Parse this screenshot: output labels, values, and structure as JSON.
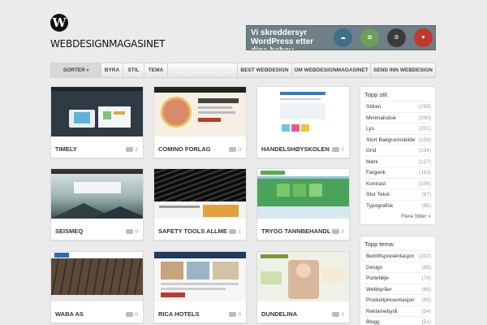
{
  "site": {
    "logo_letter": "W",
    "name": "WEBDESIGNMAGASINET"
  },
  "banner": {
    "text": "Vi skreddersyr WordPress etter dine behov",
    "accent": "#6e7f86"
  },
  "nav": {
    "left": [
      {
        "label": "SORTER",
        "active": true
      },
      {
        "label": "BYRA"
      },
      {
        "label": "STIL"
      },
      {
        "label": "TEMA"
      }
    ],
    "right": [
      {
        "label": "BEST WEBDESIGN"
      },
      {
        "label": "OM WEBDESIGNMAGASINET"
      },
      {
        "label": "SEND INN WEBDESIGN"
      }
    ]
  },
  "cards": [
    {
      "title": "TIMELY",
      "comments": "2"
    },
    {
      "title": "COMINO FORLAG",
      "comments": "0"
    },
    {
      "title": "HANDELSHØYSKOLEN BI...",
      "comments": "0"
    },
    {
      "title": "SEISMEQ",
      "comments": "0"
    },
    {
      "title": "SAFETY TOOLS ALLMET",
      "comments": "1"
    },
    {
      "title": "TRYGG TANNBEHANDLING",
      "comments": "0"
    },
    {
      "title": "WABA AS",
      "comments": "0"
    },
    {
      "title": "RICA HOTELS",
      "comments": "0"
    },
    {
      "title": "DUNDELINA",
      "comments": "0"
    }
  ],
  "sidebar": {
    "styles": {
      "title": "Topp stil:",
      "items": [
        {
          "label": "Stilren",
          "count": "(259)"
        },
        {
          "label": "Minimalistisk",
          "count": "(200)"
        },
        {
          "label": "Lys",
          "count": "(201)"
        },
        {
          "label": "Stort Bakgrunnsbilde",
          "count": "(159)"
        },
        {
          "label": "Grid",
          "count": "(134)"
        },
        {
          "label": "Mørk",
          "count": "(127)"
        },
        {
          "label": "Fargerik",
          "count": "(110)"
        },
        {
          "label": "Kontrast",
          "count": "(106)"
        },
        {
          "label": "Stor Tekst",
          "count": "(97)"
        },
        {
          "label": "Typografisk",
          "count": "(96)"
        }
      ],
      "more": "Flere Stiler »"
    },
    "topics": {
      "title": "Topp tema:",
      "items": [
        {
          "label": "Bedriftspresentasjon",
          "count": "(202)"
        },
        {
          "label": "Design",
          "count": "(89)"
        },
        {
          "label": "Portefølje",
          "count": "(79)"
        },
        {
          "label": "Webbyråer",
          "count": "(66)"
        },
        {
          "label": "Produktpresentasjon",
          "count": "(65)"
        },
        {
          "label": "Reklamebyrå",
          "count": "(54)"
        },
        {
          "label": "Blogg",
          "count": "(51)"
        }
      ]
    }
  }
}
